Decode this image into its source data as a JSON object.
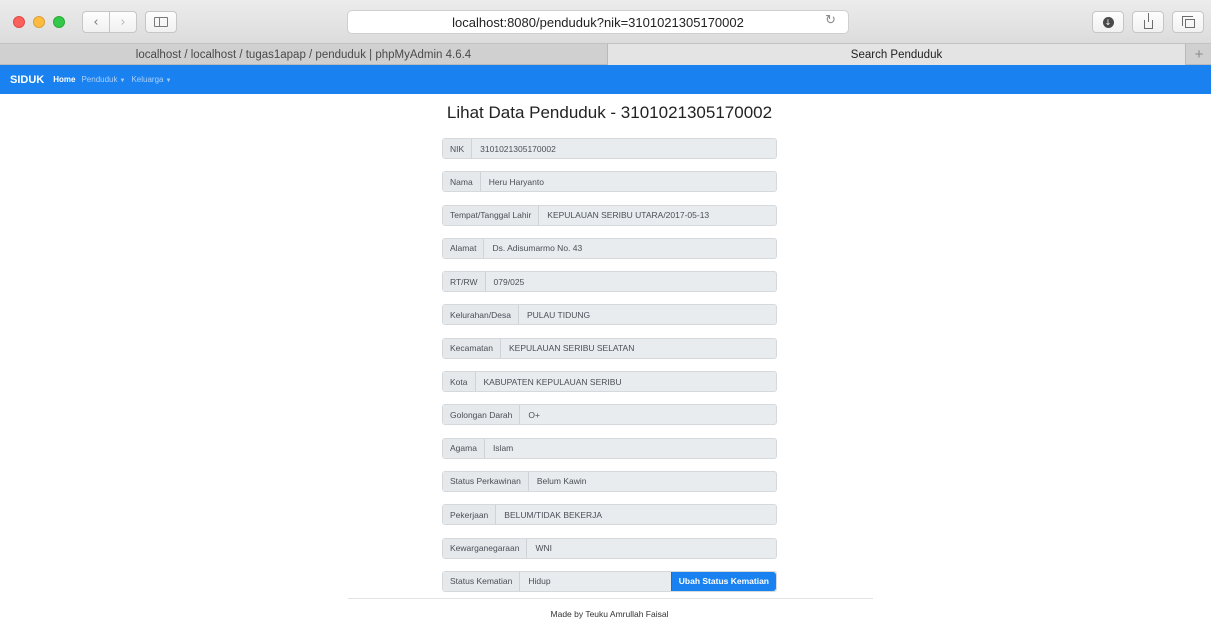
{
  "browser": {
    "url": "localhost:8080/penduduk?nik=3101021305170002",
    "tabs": [
      {
        "label": "localhost / localhost / tugas1apap / penduduk | phpMyAdmin 4.6.4"
      },
      {
        "label": "Search Penduduk"
      }
    ],
    "new_tab_label": "+"
  },
  "navbar": {
    "brand": "SIDUK",
    "links": [
      {
        "label": "Home"
      },
      {
        "label": "Penduduk"
      },
      {
        "label": "Keluarga"
      }
    ]
  },
  "page": {
    "title": "Lihat Data Penduduk - 3101021305170002",
    "fields": [
      {
        "label": "NIK",
        "value": "3101021305170002"
      },
      {
        "label": "Nama",
        "value": "Heru Haryanto"
      },
      {
        "label": "Tempat/Tanggal Lahir",
        "value": "KEPULAUAN SERIBU UTARA/2017-05-13"
      },
      {
        "label": "Alamat",
        "value": "Ds. Adisumarmo No. 43"
      },
      {
        "label": "RT/RW",
        "value": "079/025"
      },
      {
        "label": "Kelurahan/Desa",
        "value": "PULAU TIDUNG"
      },
      {
        "label": "Kecamatan",
        "value": "KEPULAUAN SERIBU SELATAN"
      },
      {
        "label": "Kota",
        "value": "KABUPATEN KEPULAUAN SERIBU"
      },
      {
        "label": "Golongan Darah",
        "value": "O+"
      },
      {
        "label": "Agama",
        "value": "Islam"
      },
      {
        "label": "Status Perkawinan",
        "value": "Belum Kawin"
      },
      {
        "label": "Pekerjaan",
        "value": "BELUM/TIDAK BEKERJA"
      },
      {
        "label": "Kewarganegaraan",
        "value": "WNI"
      },
      {
        "label": "Status Kematian",
        "value": "Hidup"
      }
    ],
    "action_button": "Ubah Status Kematian",
    "footer": "Made by Teuku Amrullah Faisal"
  },
  "colors": {
    "navbar": "#1a81f0",
    "button": "#1a81f0",
    "field_bg": "#e9ecef"
  }
}
